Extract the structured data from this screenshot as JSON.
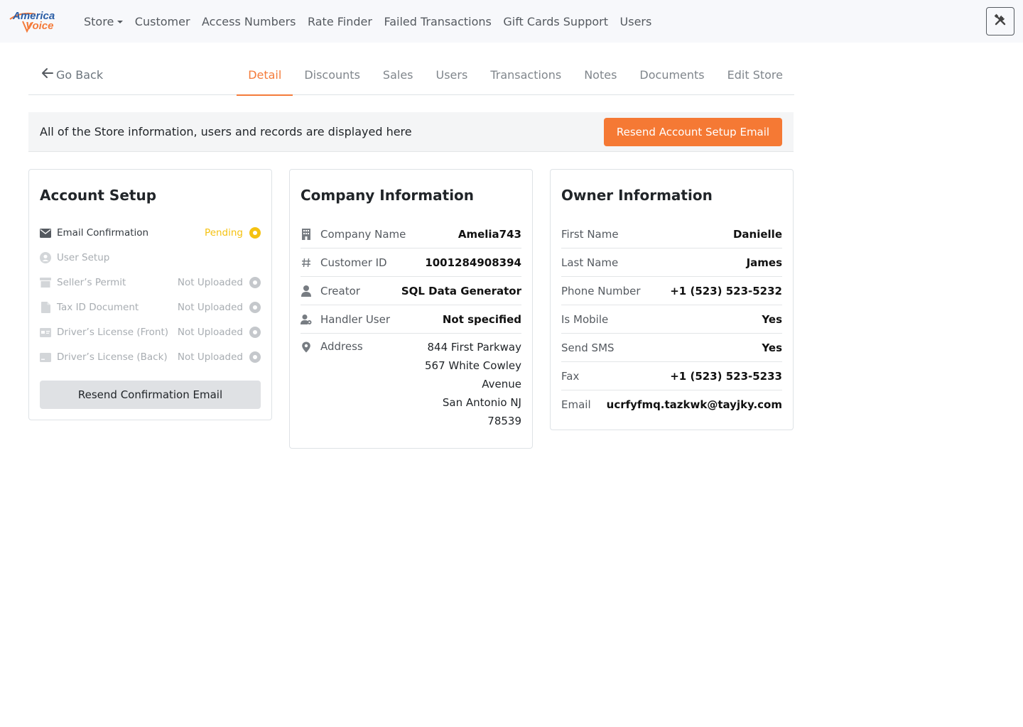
{
  "brand": {
    "line1": "America",
    "line2": "Voice",
    "accent": "#f47b3a",
    "blue": "#2b5ea6"
  },
  "nav": {
    "items": [
      {
        "label": "Store",
        "dropdown": true
      },
      {
        "label": "Customer"
      },
      {
        "label": "Access Numbers"
      },
      {
        "label": "Rate Finder"
      },
      {
        "label": "Failed Transactions"
      },
      {
        "label": "Gift Cards Support"
      },
      {
        "label": "Users"
      }
    ],
    "tools_icon": "tools-icon"
  },
  "subnav": {
    "go_back": "Go Back",
    "tabs": [
      "Detail",
      "Discounts",
      "Sales",
      "Users",
      "Transactions",
      "Notes",
      "Documents",
      "Edit Store"
    ],
    "active_tab": "Detail"
  },
  "infobar": {
    "text": "All of the Store information, users and records are displayed here",
    "button": "Resend Account Setup Email"
  },
  "account_setup": {
    "title": "Account Setup",
    "items": [
      {
        "label": "Email Confirmation",
        "status": "Pending",
        "icon": "envelope-icon"
      },
      {
        "label": "User Setup",
        "status": "",
        "icon": "user-circle-icon"
      },
      {
        "label": "Seller’s Permit",
        "status": "Not Uploaded",
        "icon": "store-icon"
      },
      {
        "label": "Tax ID Document",
        "status": "Not Uploaded",
        "icon": "file-icon"
      },
      {
        "label": "Driver’s License (Front)",
        "status": "Not Uploaded",
        "icon": "id-card-icon"
      },
      {
        "label": "Driver’s License (Back)",
        "status": "Not Uploaded",
        "icon": "card-back-icon"
      }
    ],
    "button": "Resend Confirmation Email",
    "colors": {
      "pending": "#f5c211",
      "inactive": "#c5c8cc"
    }
  },
  "company": {
    "title": "Company Information",
    "rows": [
      {
        "label": "Company Name",
        "value": "Amelia743",
        "icon": "building-icon"
      },
      {
        "label": "Customer ID",
        "value": "1001284908394",
        "icon": "hash-icon"
      },
      {
        "label": "Creator",
        "value": "SQL Data Generator",
        "icon": "user-icon"
      },
      {
        "label": "Handler User",
        "value": "Not specified",
        "icon": "user-gear-icon"
      }
    ],
    "address_label": "Address",
    "address_lines": [
      "844 First Parkway",
      "567 White Cowley",
      "Avenue",
      "San Antonio NJ",
      "78539"
    ]
  },
  "owner": {
    "title": "Owner Information",
    "rows": [
      {
        "label": "First Name",
        "value": "Danielle"
      },
      {
        "label": "Last Name",
        "value": "James"
      },
      {
        "label": "Phone Number",
        "value": "+1 (523) 523-5232"
      },
      {
        "label": "Is Mobile",
        "value": "Yes"
      },
      {
        "label": "Send SMS",
        "value": "Yes"
      },
      {
        "label": "Fax",
        "value": "+1 (523) 523-5233"
      },
      {
        "label": "Email",
        "value": "ucrfyfmq.tazkwk@tayjky.com"
      }
    ]
  }
}
